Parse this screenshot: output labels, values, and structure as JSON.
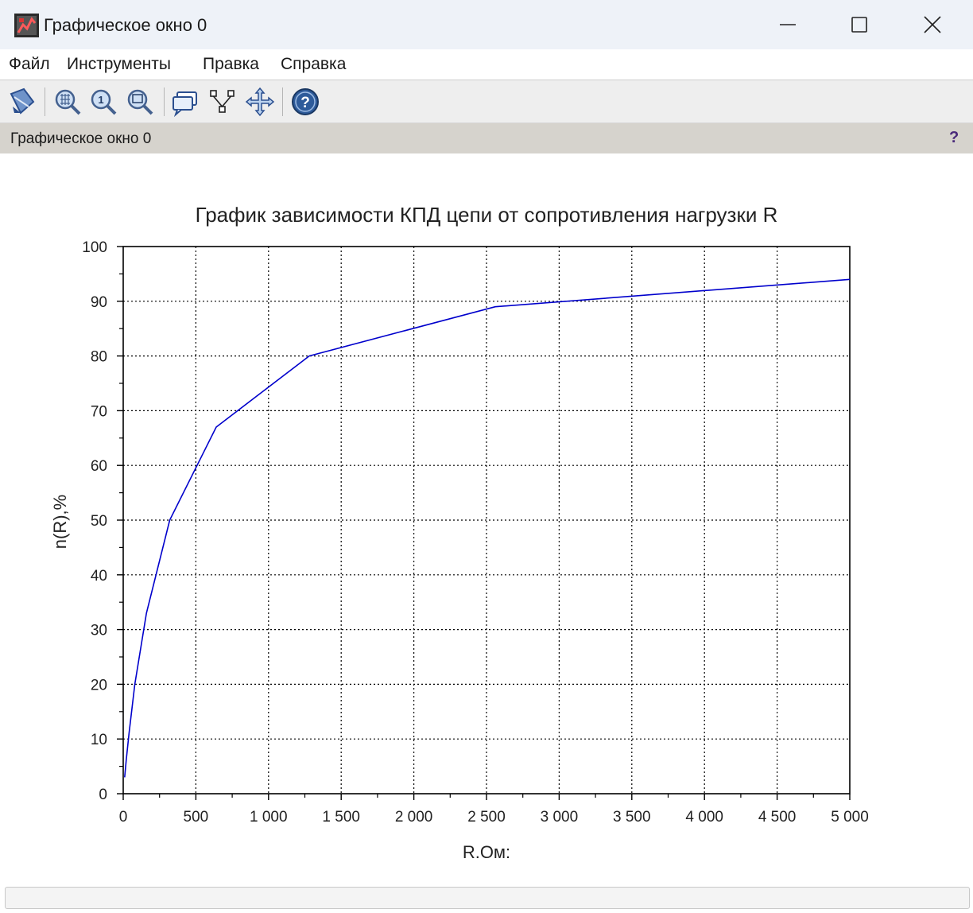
{
  "window": {
    "title": "Графическое окно 0",
    "controls": {
      "minimize": "minimize-icon",
      "maximize": "maximize-icon",
      "close": "close-icon"
    }
  },
  "menu": [
    "Файл",
    "Инструменты",
    "Правка",
    "Справка"
  ],
  "toolbar": [
    "rotate-icon",
    "zoom-icon",
    "zoom-original-icon",
    "zoom-region-icon",
    "datatip-icon",
    "datatip-edit-icon",
    "pan-icon",
    "help-icon"
  ],
  "status": {
    "label": "Графическое окно 0",
    "help": "?"
  },
  "colors": {
    "series": "#0000cc",
    "grid": "#000000",
    "titlebar": "#eef2f8",
    "status_band": "#d6d3cd"
  },
  "chart_data": {
    "type": "line",
    "title": "График зависимости КПД цепи от сопротивления нагрузки R",
    "xlabel": "R.Ом:",
    "ylabel": "n(R),%",
    "xlim": [
      0,
      5000
    ],
    "ylim": [
      0,
      100
    ],
    "x_ticks": [
      0,
      500,
      1000,
      1500,
      2000,
      2500,
      3000,
      3500,
      4000,
      4500,
      5000
    ],
    "x_tick_labels": [
      "0",
      "500",
      "1 000",
      "1 500",
      "2 000",
      "2 500",
      "3 000",
      "3 500",
      "4 000",
      "4 500",
      "5 000"
    ],
    "y_ticks": [
      0,
      10,
      20,
      30,
      40,
      50,
      60,
      70,
      80,
      90,
      100
    ],
    "y_tick_labels": [
      "0",
      "10",
      "20",
      "30",
      "40",
      "50",
      "60",
      "70",
      "80",
      "90",
      "100"
    ],
    "grid": true,
    "series": [
      {
        "x": [
          10,
          20,
          40,
          80,
          160,
          320,
          640,
          1280,
          2560,
          5000
        ],
        "y": [
          3,
          6,
          11,
          20,
          33,
          50,
          67,
          80,
          89,
          94
        ]
      }
    ]
  }
}
